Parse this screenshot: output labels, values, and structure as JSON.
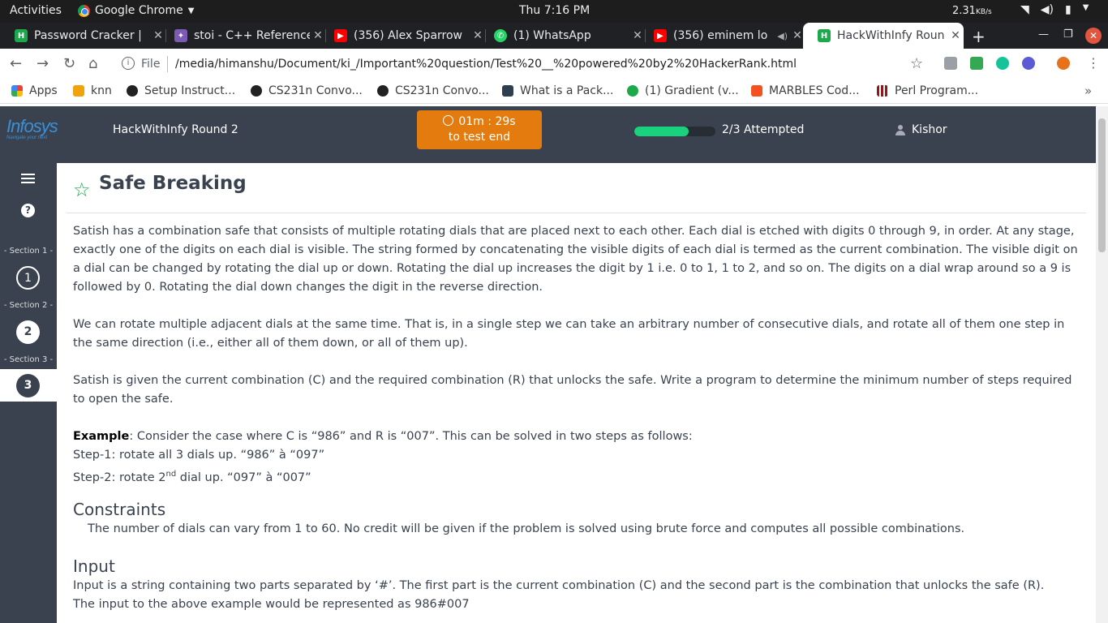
{
  "system_bar": {
    "activities": "Activities",
    "app_name": "Google Chrome",
    "clock": "Thu  7:16 PM",
    "net_speed": "2.31",
    "net_unit": "KB/s"
  },
  "tabs": [
    {
      "title": "Password Cracker |",
      "favicon_color": "#1ba94c",
      "favicon_glyph": "H"
    },
    {
      "title": "stoi - C++ Reference",
      "favicon_color": "#7b5bb4",
      "favicon_glyph": "✦"
    },
    {
      "title": "(356) Alex Sparrow",
      "favicon_color": "#ff0000",
      "favicon_glyph": "▶"
    },
    {
      "title": "(1) WhatsApp",
      "favicon_color": "#25d366",
      "favicon_glyph": "✆"
    },
    {
      "title": "(356) eminem lo",
      "favicon_color": "#ff0000",
      "favicon_glyph": "▶"
    },
    {
      "title": "HackWithInfy Roun",
      "favicon_color": "#1ba94c",
      "favicon_glyph": "H",
      "active": true
    }
  ],
  "omnibox": {
    "scheme_label": "File",
    "url": "/media/himanshu/Document/ki_/Important%20question/Test%20__%20powered%20by2%20HackerRank.html"
  },
  "bookmarks": [
    {
      "label": "Apps",
      "color": "#e74c3c"
    },
    {
      "label": "knn",
      "color": "#f0a30a"
    },
    {
      "label": "Setup Instruct...",
      "color": "#222222"
    },
    {
      "label": "CS231n Convo...",
      "color": "#222222"
    },
    {
      "label": "CS231n Convo...",
      "color": "#222222"
    },
    {
      "label": "What is a Pack...",
      "color": "#2c3e50"
    },
    {
      "label": "(1) Gradient (v...",
      "color": "#1ba94c"
    },
    {
      "label": "MARBLES Cod...",
      "color": "#f4511e"
    },
    {
      "label": "Perl Program...",
      "color": "#8b1a1a"
    }
  ],
  "header": {
    "logo": "Infosys",
    "logo_tagline": "Navigate your next",
    "contest": "HackWithInfy Round 2",
    "timer_value": "01m : 29s",
    "timer_label": "to test end",
    "progress_fraction": 0.67,
    "attempted": "2/3 Attempted",
    "user": "Kishor"
  },
  "rail": {
    "sections": [
      "- Section 1 -",
      "- Section 2 -",
      "- Section 3 -"
    ],
    "questions": [
      "1",
      "2",
      "3"
    ]
  },
  "problem": {
    "title": "Safe Breaking",
    "p1": "Satish has a combination safe that consists of multiple rotating dials that are placed next to each other. Each dial is etched with digits 0 through 9, in order. At any stage, exactly one of the digits on each dial is visible. The string formed by concatenating the visible digits of each dial is termed as the current combination. The visible digit on a dial can be changed by rotating the dial up or down.  Rotating the dial up increases the digit by 1 i.e. 0 to 1, 1 to 2, and so on. The digits on a dial wrap around so a 9 is followed by 0. Rotating the dial down changes the digit in the reverse direction.",
    "p2": "We can rotate multiple adjacent dials at the same time. That is, in a single step we can take an arbitrary number of consecutive dials, and rotate all of them one step in the same direction (i.e., either all of them down, or all of them up).",
    "p3": "Satish is given the current combination (C) and the required combination (R) that unlocks the safe. Write a program to determine the minimum number of steps required to open the safe.",
    "example_label": "Example",
    "example_text": ": Consider the case where C is “986” and R is “007”. This can be solved in two steps as follows:",
    "step1": "Step-1: rotate all 3 dials up. “986” à “097”",
    "step2_pre": "Step-2: rotate 2",
    "step2_sup": "nd",
    "step2_post": " dial up. “097” à “007”",
    "constraints_heading": "Constraints",
    "constraints_text": "The number of dials can vary from 1 to 60. No credit will be given if the problem is solved using brute force and computes all possible combinations.",
    "input_heading": "Input",
    "input_text1": "Input is a string containing two parts separated by ‘#’. The first part is the current combination (C) and the second part is the combination that unlocks the safe (R).",
    "input_text2": "The input to the above example would be represented as 986#007"
  }
}
